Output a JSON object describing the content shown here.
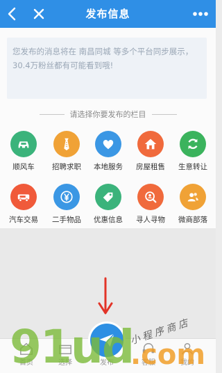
{
  "header": {
    "title": "发布信息",
    "back_icon": "back-chevron-icon",
    "close_icon": "close-icon",
    "more_icon": "more-dots-icon",
    "background": "#2f8fe6"
  },
  "notice": {
    "prefix": "您发布的消息将在",
    "city": "南昌同城",
    "suffix": "等多个平台同步展示，30.4万粉丝都有可能看到哦!"
  },
  "section_prompt": "请选择你要发布的栏目",
  "categories": [
    {
      "label": "顺风车",
      "icon": "car-icon",
      "color": "#3bb37b"
    },
    {
      "label": "招聘求职",
      "icon": "tie-icon",
      "color": "#f0a236"
    },
    {
      "label": "本地服务",
      "icon": "heart-icon",
      "color": "#3b97e4"
    },
    {
      "label": "房屋租售",
      "icon": "house-icon",
      "color": "#f06a3c"
    },
    {
      "label": "生意转让",
      "icon": "refresh-icon",
      "color": "#3bb35d"
    },
    {
      "label": "汽车交易",
      "icon": "vehicle-icon",
      "color": "#f05a3a"
    },
    {
      "label": "二手物品",
      "icon": "yen-icon",
      "color": "#3b97e4"
    },
    {
      "label": "优惠信息",
      "icon": "tag-icon",
      "color": "#3bb37b"
    },
    {
      "label": "寻人寻物",
      "icon": "search-person-icon",
      "color": "#f06a3c"
    },
    {
      "label": "微商部落",
      "icon": "people-icon",
      "color": "#f0a236"
    }
  ],
  "tabbar": {
    "items": [
      {
        "label": "首页",
        "icon": "home-icon"
      },
      {
        "label": "选择",
        "icon": "store-icon"
      },
      {
        "label": "发布",
        "icon": "publish-plane-icon"
      },
      {
        "label": "客服",
        "icon": "service-icon"
      },
      {
        "label": "我的",
        "icon": "user-icon"
      }
    ]
  },
  "watermark": {
    "text": "91ud",
    "suffix": ".com",
    "script": "小程序商店"
  }
}
